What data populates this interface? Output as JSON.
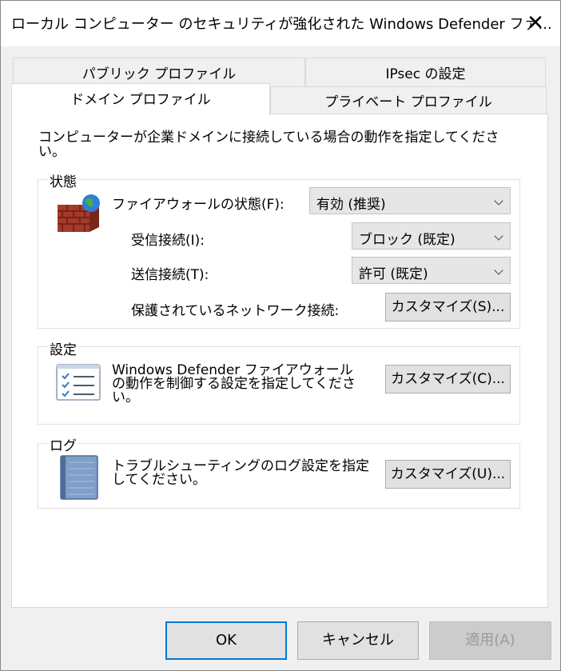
{
  "window": {
    "title": "ローカル コンピューター のセキュリティが強化された Windows Defender ファ...",
    "close_glyph": "✕"
  },
  "tabs": [
    {
      "label": "パブリック プロファイル"
    },
    {
      "label": "IPsec の設定"
    },
    {
      "label": "ドメイン プロファイル",
      "active": true
    },
    {
      "label": "プライベート プロファイル"
    }
  ],
  "description": "コンピューターが企業ドメインに接続している場合の動作を指定してください。",
  "state_group": {
    "title": "状態",
    "icon": "firewall-icon",
    "firewall_state_label": "ファイアウォールの状態(F):",
    "firewall_state_value": "有効 (推奨)",
    "inbound_label": "受信接続(I):",
    "inbound_value": "ブロック (既定)",
    "outbound_label": "送信接続(T):",
    "outbound_value": "許可 (既定)",
    "protected_label": "保護されているネットワーク接続:",
    "protected_button": "カスタマイズ(S)..."
  },
  "settings_group": {
    "title": "設定",
    "icon": "checklist-icon",
    "text": "Windows Defender ファイアウォールの動作を制御する設定を指定してください。",
    "button": "カスタマイズ(C)..."
  },
  "log_group": {
    "title": "ログ",
    "icon": "log-notebook-icon",
    "text": "トラブルシューティングのログ設定を指定してください。",
    "button": "カスタマイズ(U)..."
  },
  "footer": {
    "ok": "OK",
    "cancel": "キャンセル",
    "apply": "適用(A)"
  },
  "colors": {
    "focus_border": "#0078d7",
    "panel_bg": "#ffffff",
    "window_bg": "#f0f0f0"
  }
}
